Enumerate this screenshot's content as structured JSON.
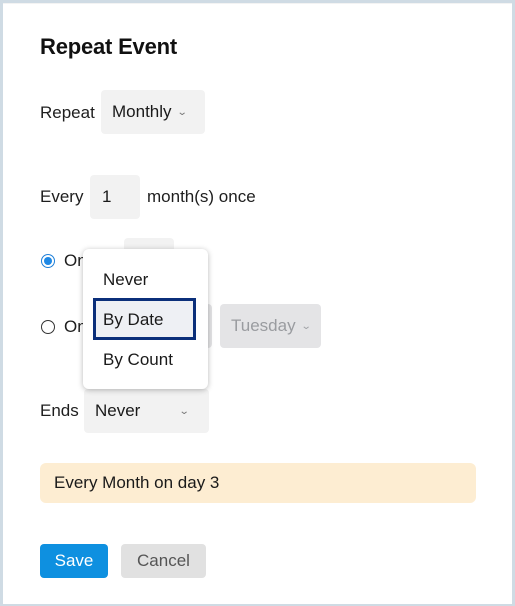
{
  "dialog": {
    "title": "Repeat Event"
  },
  "repeat": {
    "label": "Repeat",
    "value": "Monthly",
    "chevron_icon": "chevron-down-icon"
  },
  "every": {
    "label": "Every",
    "value": "1",
    "suffix": "month(s) once"
  },
  "option_on_day": {
    "label": "On",
    "checked": true,
    "day_value": ""
  },
  "option_on_weekday": {
    "label": "On",
    "checked": false,
    "weekday_value": "Tuesday"
  },
  "ends": {
    "label": "Ends",
    "value": "Never",
    "dropdown_open": true,
    "options": [
      {
        "label": "Never"
      },
      {
        "label": "By Date",
        "highlighted": true
      },
      {
        "label": "By Count"
      }
    ]
  },
  "summary": {
    "text": "Every Month on day 3"
  },
  "buttons": {
    "save": "Save",
    "cancel": "Cancel"
  },
  "colors": {
    "primary": "#0e90e0",
    "summary_bg": "#fdedd2",
    "highlight_border": "#0b2f7a",
    "frame": "#cfdbe4"
  }
}
